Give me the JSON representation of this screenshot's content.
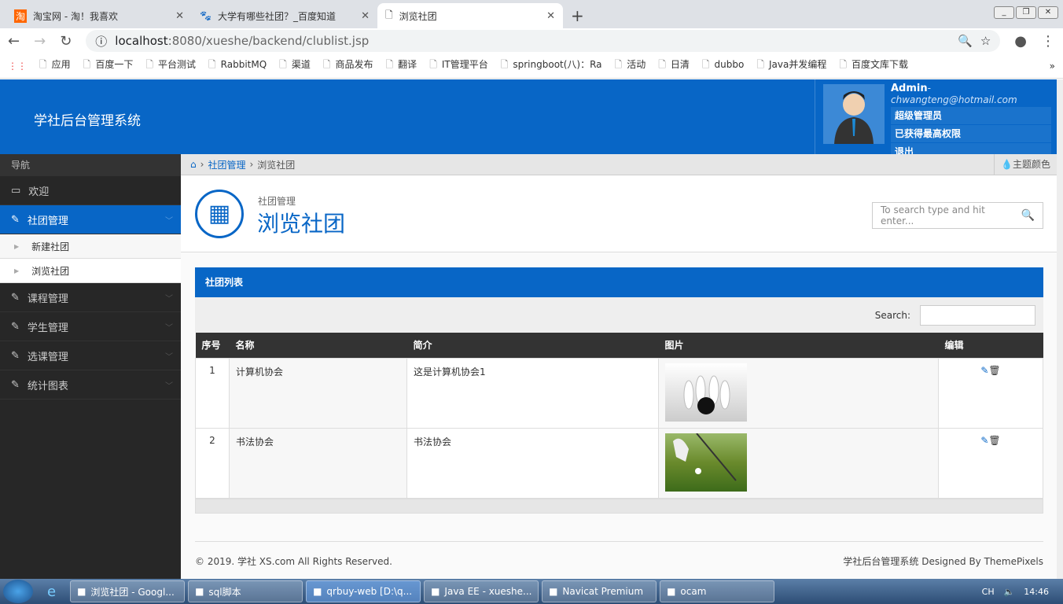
{
  "browser": {
    "tabs": [
      {
        "title": "淘宝网 - 淘！我喜欢",
        "icon": "taobao-icon"
      },
      {
        "title": "大学有哪些社团？_百度知道",
        "icon": "baidu-paw-icon"
      },
      {
        "title": "浏览社团",
        "icon": "page-icon"
      }
    ],
    "url_host": "localhost",
    "url_rest": ":8080/xueshe/backend/clublist.jsp",
    "bookmarks": [
      "应用",
      "百度一下",
      "平台测试",
      "RabbitMQ",
      "渠道",
      "商品发布",
      "翻译",
      "IT管理平台",
      "springboot(八)：Ra",
      "活动",
      "日清",
      "dubbo",
      "Java并发编程",
      "百度文库下载"
    ]
  },
  "header": {
    "logo": "学社后台管理系统",
    "user_name": "Admin",
    "user_email": "- chwangteng@hotmail.com",
    "role": "超级管理员",
    "perm": "已获得最高权限",
    "logout": "退出"
  },
  "sidebar": {
    "title": "导航",
    "items": [
      {
        "label": "欢迎",
        "icon": "laptop-icon"
      },
      {
        "label": "社团管理",
        "icon": "pencil-icon",
        "active": true
      },
      {
        "label": "课程管理",
        "icon": "pencil-icon"
      },
      {
        "label": "学生管理",
        "icon": "pencil-icon"
      },
      {
        "label": "选课管理",
        "icon": "pencil-icon"
      },
      {
        "label": "统计图表",
        "icon": "pencil-icon"
      }
    ],
    "sub": [
      "新建社团",
      "浏览社团"
    ]
  },
  "breadcrumb": {
    "parent": "社团管理",
    "current": "浏览社团",
    "theme": "主题颜色"
  },
  "page": {
    "sub": "社团管理",
    "title": "浏览社团",
    "search_placeholder": "To search type and hit enter..."
  },
  "table": {
    "title": "社团列表",
    "search_label": "Search:",
    "columns": [
      "序号",
      "名称",
      "简介",
      "图片",
      "编辑"
    ],
    "rows": [
      {
        "no": "1",
        "name": "计算机协会",
        "desc": "这是计算机协会1",
        "image": "bowling"
      },
      {
        "no": "2",
        "name": "书法协会",
        "desc": "书法协会",
        "image": "golf"
      }
    ]
  },
  "footer": {
    "left": "© 2019. 学社 XS.com All Rights Reserved.",
    "right": "学社后台管理系统  Designed By ThemePixels"
  },
  "taskbar": {
    "items": [
      "浏览社团 - Googl...",
      "sql脚本",
      "qrbuy-web [D:\\q...",
      "Java EE - xueshe...",
      "Navicat Premium",
      "ocam"
    ],
    "lang": "CH",
    "time": "14:46"
  },
  "colors": {
    "accent": "#0866c6",
    "sidebar": "#272727"
  }
}
